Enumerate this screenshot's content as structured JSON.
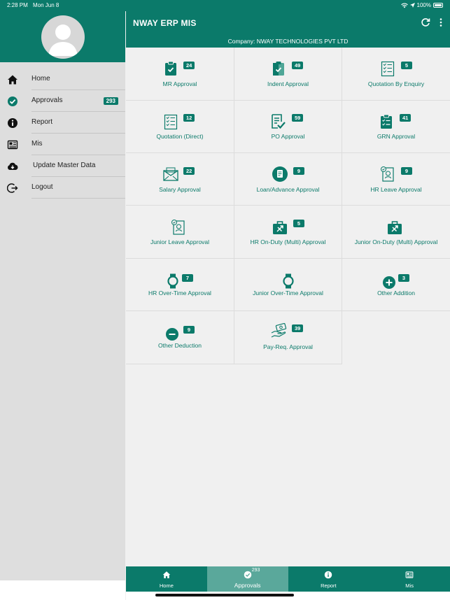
{
  "status": {
    "time": "2:28 PM",
    "date": "Mon Jun 8",
    "battery": "100%"
  },
  "app": {
    "title": "NWAY ERP MIS",
    "company": "Company: NWAY TECHNOLOGIES PVT LTD"
  },
  "sidebar": {
    "items": [
      {
        "label": "Home",
        "icon": "home-icon"
      },
      {
        "label": "Approvals",
        "icon": "check-circle-icon",
        "badge": "293"
      },
      {
        "label": "Report",
        "icon": "info-icon"
      },
      {
        "label": "Mis",
        "icon": "newspaper-icon"
      },
      {
        "label": "Update Master Data",
        "icon": "cloud-download-icon"
      },
      {
        "label": "Logout",
        "icon": "logout-icon"
      }
    ]
  },
  "tiles": [
    {
      "label": "MR Approval",
      "badge": "24",
      "icon": "clipboard-check-icon"
    },
    {
      "label": "Indent Approval",
      "badge": "49",
      "icon": "clipboard-tick-icon"
    },
    {
      "label": "Quotation By Enquiry",
      "badge": "5",
      "icon": "checklist-icon"
    },
    {
      "label": "Quotation (Direct)",
      "badge": "12",
      "icon": "checklist-icon"
    },
    {
      "label": "PO Approval",
      "badge": "59",
      "icon": "document-check-icon"
    },
    {
      "label": "GRN Approval",
      "badge": "41",
      "icon": "clipboard-list-icon"
    },
    {
      "label": "Salary Approval",
      "badge": "22",
      "icon": "envelope-icon"
    },
    {
      "label": "Loan/Advance Approval",
      "badge": "9",
      "icon": "loan-icon"
    },
    {
      "label": "HR Leave Approval",
      "badge": "9",
      "icon": "id-document-icon"
    },
    {
      "label": "Junior Leave Approval",
      "badge": "",
      "icon": "id-document-icon"
    },
    {
      "label": "HR On-Duty (Multi) Approval",
      "badge": "5",
      "icon": "briefcase-plane-icon"
    },
    {
      "label": "Junior On-Duty (Multi) Approval",
      "badge": "",
      "icon": "briefcase-plane-icon"
    },
    {
      "label": "HR Over-Time Approval",
      "badge": "7",
      "icon": "watch-icon"
    },
    {
      "label": "Junior Over-Time Approval",
      "badge": "",
      "icon": "watch-icon"
    },
    {
      "label": "Other Addition",
      "badge": "3",
      "icon": "plus-circle-icon"
    },
    {
      "label": "Other Deduction",
      "badge": "9",
      "icon": "minus-circle-icon"
    },
    {
      "label": "Pay-Req. Approval",
      "badge": "39",
      "icon": "hand-money-icon"
    }
  ],
  "bottom_nav": [
    {
      "label": "Home",
      "icon": "home-icon"
    },
    {
      "label": "Approvals",
      "icon": "check-circle-icon",
      "badge": "293",
      "active": true
    },
    {
      "label": "Report",
      "icon": "info-icon"
    },
    {
      "label": "Mis",
      "icon": "newspaper-icon"
    }
  ],
  "colors": {
    "primary": "#0b7a6a",
    "active_tab": "#5aa89b",
    "sidebar_bg": "#dedede"
  }
}
